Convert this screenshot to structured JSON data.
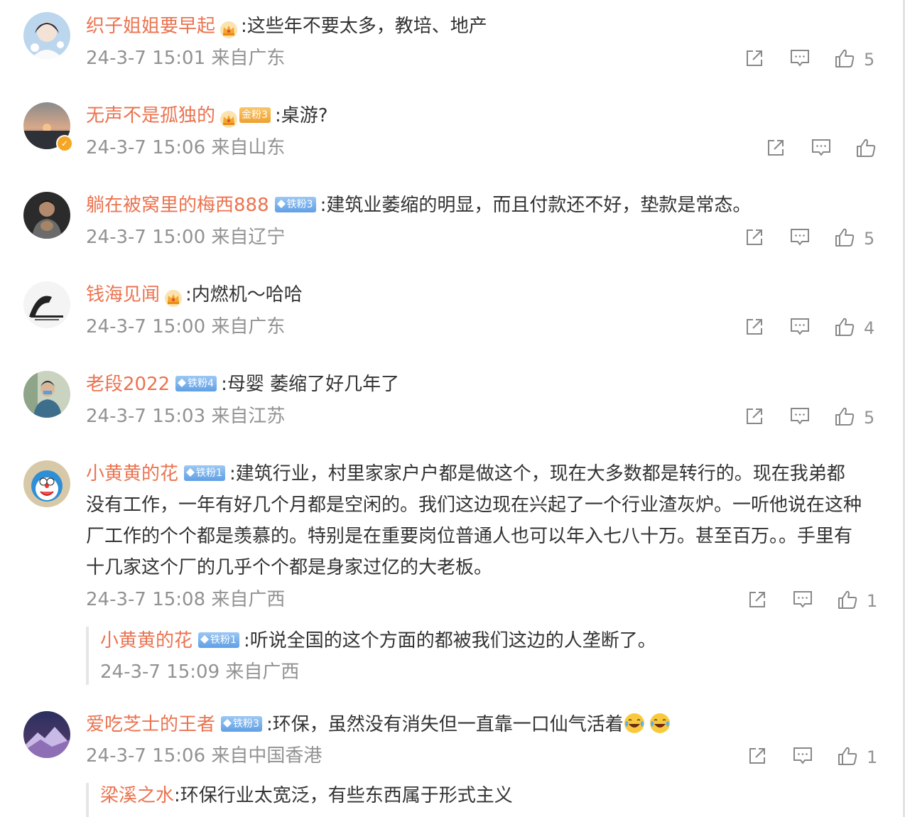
{
  "comments": [
    {
      "username": "织子姐姐要早起",
      "crown": true,
      "badge": null,
      "text": ":这些年不要太多，教培、地产",
      "time": "24-3-7 15:01 来自广东",
      "likes": "5",
      "verified": false
    },
    {
      "username": "无声不是孤独的",
      "crown": true,
      "badge": "金粉3",
      "badge_color": "gold",
      "text": ":桌游?",
      "time": "24-3-7 15:06 来自山东",
      "likes": "",
      "verified": true
    },
    {
      "username": "躺在被窝里的梅西888",
      "crown": false,
      "badge": "铁粉3",
      "text": ":建筑业萎缩的明显，而且付款还不好，垫款是常态。",
      "time": "24-3-7 15:00 来自辽宁",
      "likes": "5",
      "verified": false
    },
    {
      "username": "钱海见闻",
      "crown": true,
      "badge": null,
      "text": ":内燃机～哈哈",
      "time": "24-3-7 15:00 来自广东",
      "likes": "4",
      "verified": false
    },
    {
      "username": "老段2022",
      "crown": false,
      "badge": "铁粉4",
      "text": ":母婴 萎缩了好几年了",
      "time": "24-3-7 15:03 来自江苏",
      "likes": "5",
      "verified": false
    },
    {
      "username": "小黄黄的花",
      "crown": false,
      "badge": "铁粉1",
      "text_lines": [
        ":建筑行业，村里家家户户都是做这个，现在大多数都是转行的。现在我弟都",
        "没有工作，一年有好几个月都是空闲的。我们这边现在兴起了一个行业渣灰炉。一听他说在这种",
        "厂工作的个个都是羡慕的。特别是在重要岗位普通人也可以年入七八十万。甚至百万。。手里有",
        "十几家这个厂的几乎个个都是身家过亿的大老板。"
      ],
      "time": "24-3-7 15:08 来自广西",
      "likes": "1",
      "reply": {
        "username": "小黄黄的花",
        "badge": "铁粉1",
        "text": ":听说全国的这个方面的都被我们这边的人垄断了。",
        "time": "24-3-7 15:09 来自广西"
      }
    },
    {
      "username": "爱吃芝士的王者",
      "crown": false,
      "badge": "铁粉3",
      "text": ":环保，虽然没有消失但一直靠一口仙气活着",
      "time": "24-3-7 15:06 来自中国香港",
      "likes": "1",
      "reply": {
        "username": "梁溪之水",
        "text": ":环保行业太宽泛，有些东西属于形式主义"
      }
    }
  ],
  "colors": {
    "username": "#eb7350",
    "meta": "#929292",
    "text": "#333333"
  },
  "icons": {
    "share": "share-icon",
    "comment": "comment-icon",
    "like": "like-icon",
    "crown": "crown-icon",
    "badge": "diamond-icon",
    "emoji": "laugh-cry-emoji"
  }
}
